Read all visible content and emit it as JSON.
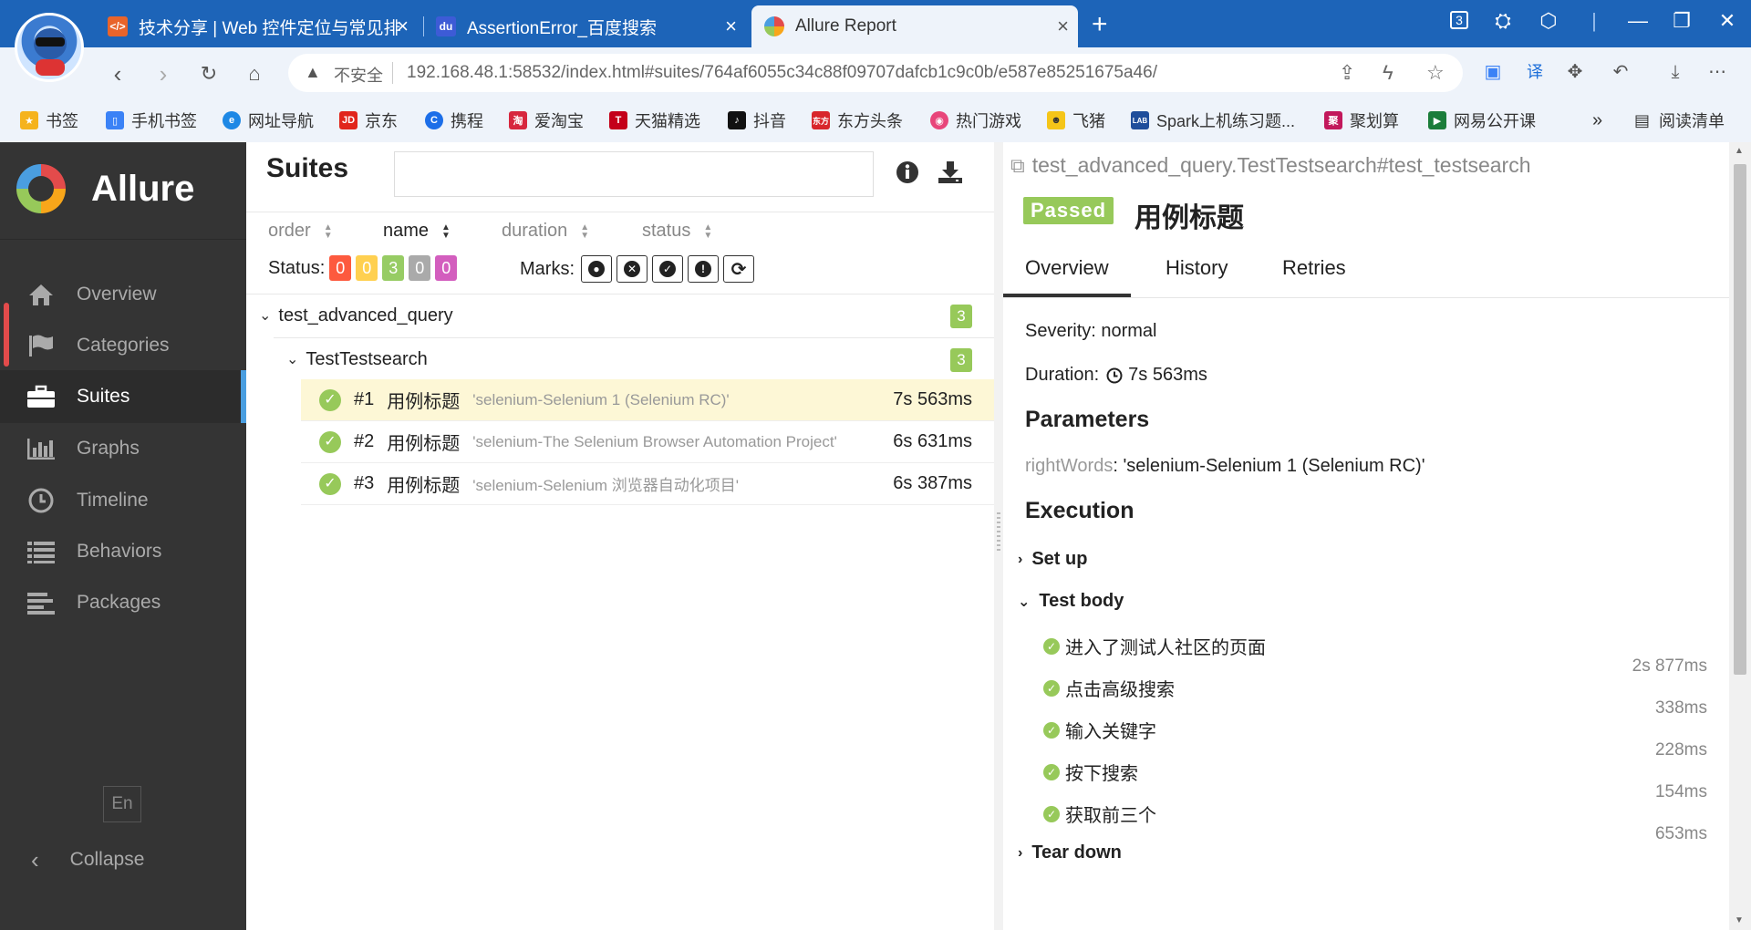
{
  "browser": {
    "tabs": [
      {
        "label": "技术分享 | Web 控件定位与常见排",
        "icon_text": "</>",
        "icon_color": "#e8642b"
      },
      {
        "label": "AssertionError_百度搜索",
        "icon_text": "du",
        "icon_color": "#3d5bd6"
      },
      {
        "label": "Allure Report",
        "icon_text": "",
        "icon_color": "#f8a61a"
      }
    ],
    "insecure_label": "不安全",
    "url": "192.168.48.1:58532/index.html#suites/764af6055c34c88f09707dafcb1c9c0b/e587e85251675a46/",
    "tab_count_badge": "3",
    "bookmarks": [
      {
        "label": "书签",
        "color": "#f5b31d"
      },
      {
        "label": "手机书签",
        "color": "#3b82f6"
      },
      {
        "label": "网址导航",
        "color": "#1e88e5"
      },
      {
        "label": "京东",
        "color": "#e1251b"
      },
      {
        "label": "携程",
        "color": "#1c6ee8"
      },
      {
        "label": "爱淘宝",
        "color": "#d7263d"
      },
      {
        "label": "天猫精选",
        "color": "#c4001a"
      },
      {
        "label": "抖音",
        "color": "#111111"
      },
      {
        "label": "东方头条",
        "color": "#d8262b"
      },
      {
        "label": "热门游戏",
        "color": "#e8457a"
      },
      {
        "label": "飞猪",
        "color": "#f5c518"
      },
      {
        "label": "Spark上机练习题...",
        "color": "#1f4e9b"
      },
      {
        "label": "聚划算",
        "color": "#c2185b"
      },
      {
        "label": "网易公开课",
        "color": "#1b7d3a"
      }
    ],
    "bookmarks_more": "»",
    "reading_list": "阅读清单"
  },
  "sidebar": {
    "brand": "Allure",
    "items": [
      {
        "label": "Overview",
        "icon": "home-icon"
      },
      {
        "label": "Categories",
        "icon": "flag-icon"
      },
      {
        "label": "Suites",
        "icon": "briefcase-icon"
      },
      {
        "label": "Graphs",
        "icon": "bar-chart-icon"
      },
      {
        "label": "Timeline",
        "icon": "clock-icon"
      },
      {
        "label": "Behaviors",
        "icon": "list-icon"
      },
      {
        "label": "Packages",
        "icon": "align-left-icon"
      }
    ],
    "active": "Suites",
    "language": "En",
    "collapse_label": "Collapse"
  },
  "suites": {
    "title": "Suites",
    "search_value": "",
    "sort_columns": [
      "order",
      "name",
      "duration",
      "status"
    ],
    "active_sort": "name",
    "status_label": "Status:",
    "status_counts": [
      {
        "value": "0",
        "color": "#fd5a3e"
      },
      {
        "value": "0",
        "color": "#ffd050"
      },
      {
        "value": "3",
        "color": "#97cc64"
      },
      {
        "value": "0",
        "color": "#aaaaaa"
      },
      {
        "value": "0",
        "color": "#d35ebe"
      }
    ],
    "marks_label": "Marks:",
    "marks": [
      "bomb-icon",
      "times-circle-icon",
      "check-circle-icon",
      "exclamation-circle-icon",
      "refresh-icon"
    ],
    "groups": [
      {
        "name": "test_advanced_query",
        "count": "3"
      },
      {
        "name": "TestTestsearch",
        "count": "3"
      }
    ],
    "cases": [
      {
        "num": "#1",
        "name": "用例标题",
        "param": "'selenium-Selenium 1 (Selenium RC)'",
        "duration": "7s 563ms"
      },
      {
        "num": "#2",
        "name": "用例标题",
        "param": "'selenium-The Selenium Browser Automation Project'",
        "duration": "6s 631ms"
      },
      {
        "num": "#3",
        "name": "用例标题",
        "param": "'selenium-Selenium 浏览器自动化项目'",
        "duration": "6s 387ms"
      }
    ]
  },
  "detail": {
    "full_name": "test_advanced_query.TestTestsearch#test_testsearch",
    "status": "Passed",
    "title": "用例标题",
    "tabs": [
      "Overview",
      "History",
      "Retries"
    ],
    "severity": "Severity: normal",
    "duration_label": "Duration:",
    "duration_value": "7s 563ms",
    "parameters_heading": "Parameters",
    "param_name": "rightWords",
    "param_value": ": 'selenium-Selenium 1 (Selenium RC)'",
    "execution_heading": "Execution",
    "setup_label": "Set up",
    "test_body_label": "Test body",
    "steps": [
      {
        "label": "进入了测试人社区的页面",
        "duration": "2s 877ms"
      },
      {
        "label": "点击高级搜索",
        "duration": "338ms"
      },
      {
        "label": "输入关键字",
        "duration": "228ms"
      },
      {
        "label": "按下搜索",
        "duration": "154ms"
      },
      {
        "label": "获取前三个",
        "duration": "653ms"
      }
    ],
    "teardown_label": "Tear down"
  }
}
